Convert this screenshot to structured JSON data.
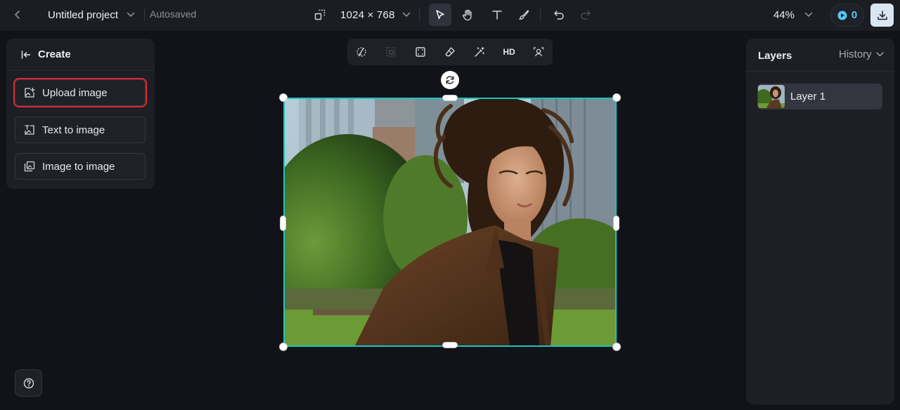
{
  "topbar": {
    "project_name": "Untitled project",
    "autosave_status": "Autosaved",
    "canvas_size": "1024 × 768",
    "zoom": "44%",
    "credits": "0"
  },
  "create_panel": {
    "title": "Create",
    "options": [
      {
        "label": "Upload image",
        "icon": "upload-image-icon",
        "selected": true
      },
      {
        "label": "Text to image",
        "icon": "text-to-image-icon",
        "selected": false
      },
      {
        "label": "Image to image",
        "icon": "image-to-image-icon",
        "selected": false
      }
    ]
  },
  "image_toolbar": {
    "hd_label": "HD"
  },
  "layers_panel": {
    "title": "Layers",
    "history_tab": "History",
    "layers": [
      {
        "label": "Layer 1"
      }
    ]
  },
  "colors": {
    "selection_border": "#14c6c0",
    "highlight_box": "#e0282d",
    "credit_accent": "#55c8f5"
  }
}
